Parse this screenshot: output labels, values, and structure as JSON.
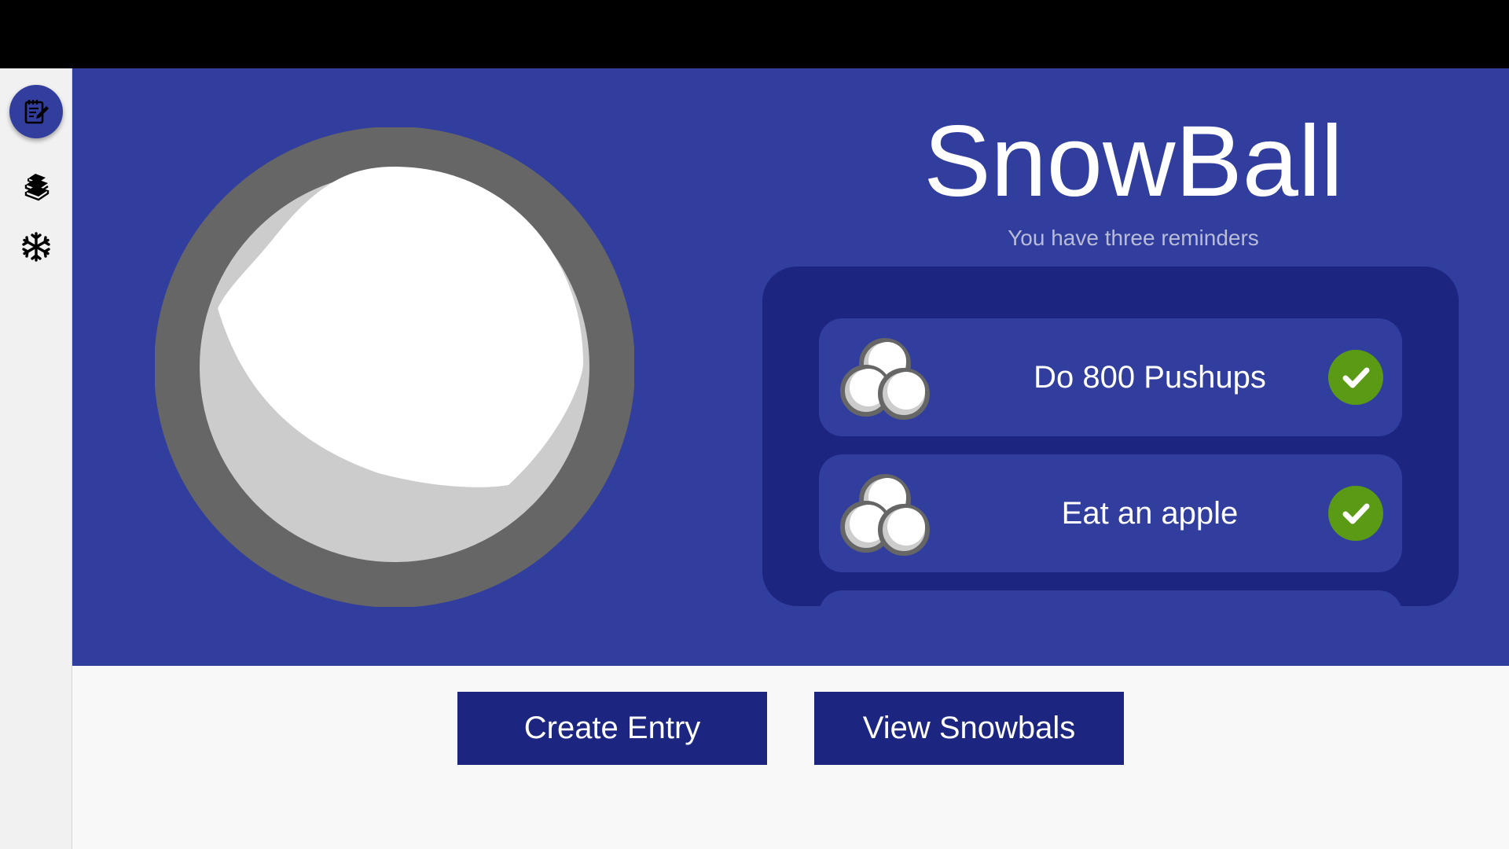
{
  "app": {
    "title": "SnowBall",
    "subtitle": "You have three reminders"
  },
  "sidebar": {
    "items": [
      {
        "icon": "notepad-edit-icon",
        "active": true
      },
      {
        "icon": "books-icon",
        "active": false
      },
      {
        "icon": "snowflake-icon",
        "active": false
      }
    ]
  },
  "reminders": [
    {
      "label": "Do 800 Pushups",
      "done": true
    },
    {
      "label": "Eat an apple",
      "done": true
    },
    {
      "label": "",
      "done": false
    }
  ],
  "actions": {
    "create_label": "Create Entry",
    "view_label": "View Snowbals"
  },
  "colors": {
    "hero_bg": "#313e9e",
    "panel_bg": "#1c2580",
    "check_green": "#5a9a14",
    "ring_gray": "#666666"
  }
}
